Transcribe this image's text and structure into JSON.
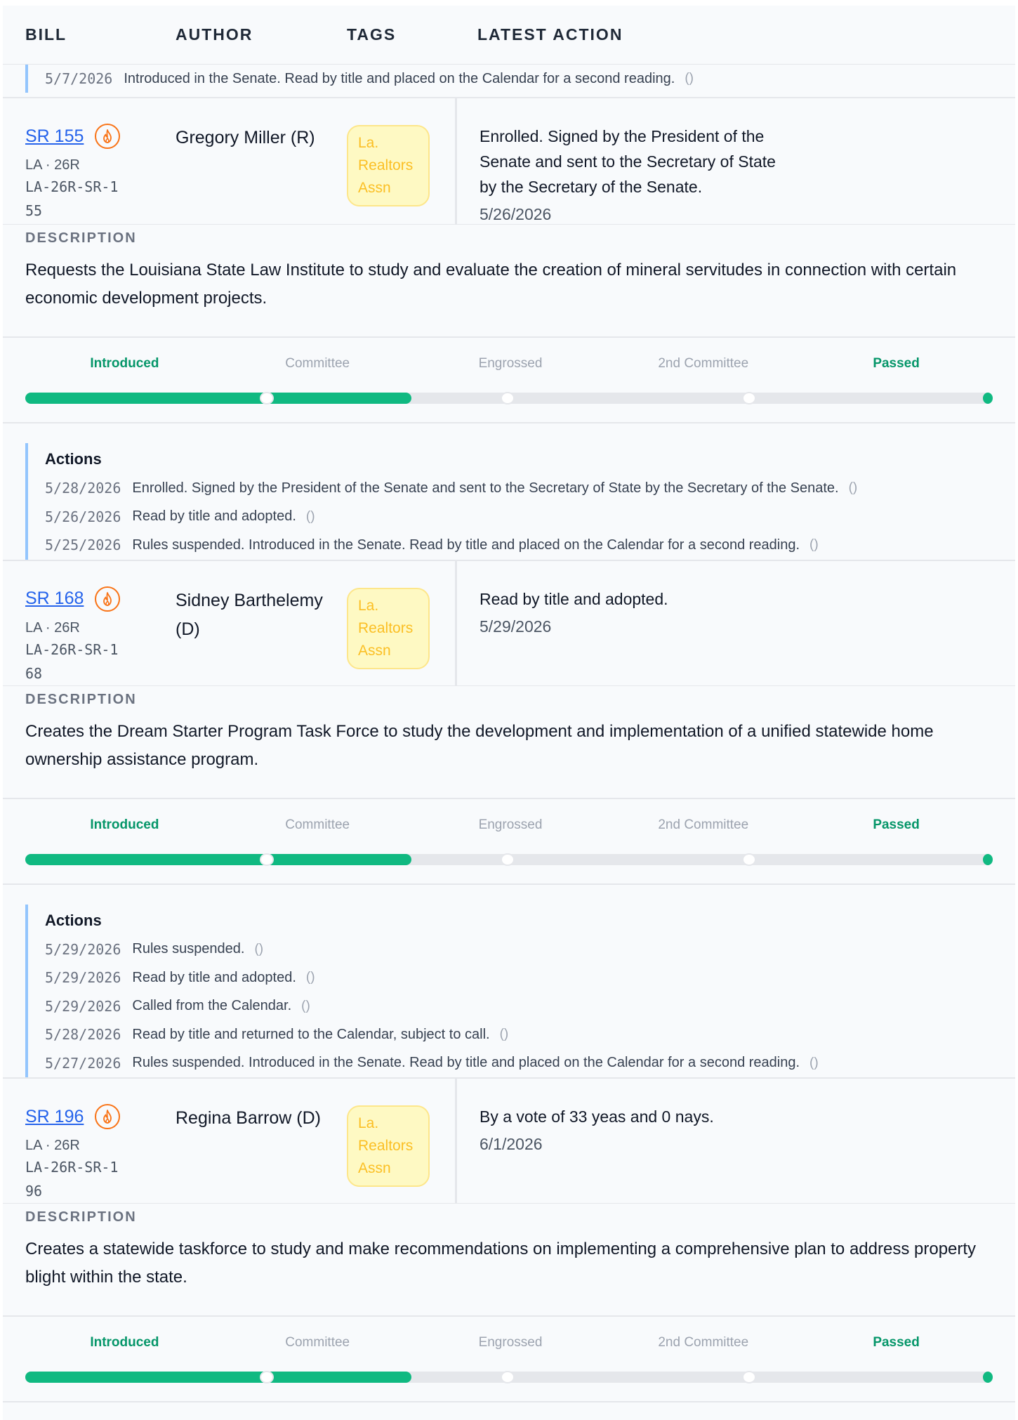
{
  "header": {
    "bill": "BILL",
    "author": "AUTHOR",
    "tags": "TAGS",
    "latest_action": "LATEST ACTION"
  },
  "prior": {
    "date": "5/7/2026",
    "text": "Introduced in the Senate. Read by title and placed on the Calendar for a second reading.",
    "paren": "()"
  },
  "labels": {
    "description": "DESCRIPTION",
    "actions": "Actions"
  },
  "stages": [
    "Introduced",
    "Committee",
    "Engrossed",
    "2nd Committee",
    "Passed"
  ],
  "stage_state": [
    true,
    false,
    false,
    false,
    true
  ],
  "icons": {
    "hot": "fire-icon"
  },
  "colors": {
    "link": "#2563eb",
    "progress": "#10b981",
    "tag_text": "#fbbf24",
    "timeline_border": "#93c5fd"
  },
  "bills": [
    {
      "number": "SR 155",
      "meta": "LA · 26R",
      "id": "LA-26R-SR-155",
      "author": "Gregory Miller (R)",
      "tag": "La. Realtors Assn",
      "latest_text": "Enrolled. Signed by the President of the Senate and sent to the Secretary of State by the Secretary of the Senate.",
      "latest_date": "5/26/2026",
      "description": "Requests the Louisiana State Law Institute to study and evaluate the creation of mineral servitudes in connection with certain economic development projects.",
      "progress_fraction": 0.4,
      "actions": [
        {
          "date": "5/28/2026",
          "text": "Enrolled. Signed by the President of the Senate and sent to the Secretary of State by the Secretary of the Senate.",
          "paren": "()"
        },
        {
          "date": "5/26/2026",
          "text": "Read by title and adopted.",
          "paren": "()"
        },
        {
          "date": "5/25/2026",
          "text": "Rules suspended. Introduced in the Senate. Read by title and placed on the Calendar for a second reading.",
          "paren": "()"
        }
      ]
    },
    {
      "number": "SR 168",
      "meta": "LA · 26R",
      "id": "LA-26R-SR-168",
      "author": "Sidney Barthelemy (D)",
      "tag": "La. Realtors Assn",
      "latest_text": "Read by title and adopted.",
      "latest_date": "5/29/2026",
      "description": "Creates the Dream Starter Program Task Force to study the development and implementation of a unified statewide home ownership assistance program.",
      "progress_fraction": 0.4,
      "actions": [
        {
          "date": "5/29/2026",
          "text": "Rules suspended.",
          "paren": "()"
        },
        {
          "date": "5/29/2026",
          "text": "Read by title and adopted.",
          "paren": "()"
        },
        {
          "date": "5/29/2026",
          "text": "Called from the Calendar.",
          "paren": "()"
        },
        {
          "date": "5/28/2026",
          "text": "Read by title and returned to the Calendar, subject to call.",
          "paren": "()"
        },
        {
          "date": "5/27/2026",
          "text": "Rules suspended. Introduced in the Senate. Read by title and placed on the Calendar for a second reading.",
          "paren": "()"
        }
      ]
    },
    {
      "number": "SR 196",
      "meta": "LA · 26R",
      "id": "LA-26R-SR-196",
      "author": "Regina Barrow (D)",
      "tag": "La. Realtors Assn",
      "latest_text": "By a vote of 33 yeas and 0 nays.",
      "latest_date": "6/1/2026",
      "description": "Creates a statewide taskforce to study and make recommendations on implementing a comprehensive plan to address property blight within the state.",
      "progress_fraction": 0.4,
      "actions": []
    }
  ]
}
